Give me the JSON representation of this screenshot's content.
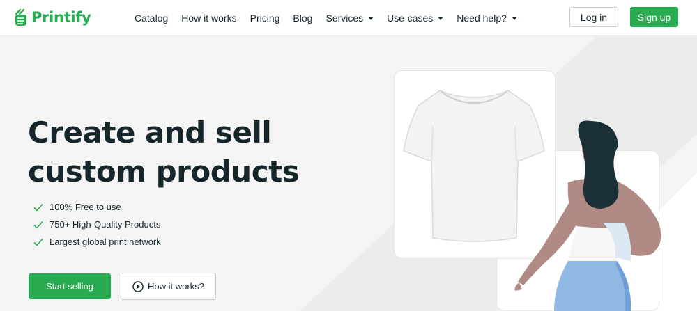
{
  "brand": {
    "name": "Printify",
    "color": "#29ab51"
  },
  "nav": {
    "items": [
      {
        "label": "Catalog",
        "dropdown": false
      },
      {
        "label": "How it works",
        "dropdown": false
      },
      {
        "label": "Pricing",
        "dropdown": false
      },
      {
        "label": "Blog",
        "dropdown": false
      },
      {
        "label": "Services",
        "dropdown": true
      },
      {
        "label": "Use-cases",
        "dropdown": true
      },
      {
        "label": "Need help?",
        "dropdown": true
      }
    ]
  },
  "auth": {
    "login_label": "Log in",
    "signup_label": "Sign up"
  },
  "hero": {
    "title_line1": "Create and sell",
    "title_line2": "custom products",
    "features": [
      "100% Free to use",
      "750+ High-Quality Products",
      "Largest global print network"
    ],
    "primary_cta": "Start selling",
    "secondary_cta": "How it works?"
  },
  "icons": {
    "logo": "printify-logo-icon",
    "check": "check-icon",
    "play": "play-circle-icon",
    "caret": "chevron-down-icon"
  },
  "colors": {
    "accent": "#29ab51",
    "text": "#17262b",
    "background": "#f4f4f4"
  }
}
